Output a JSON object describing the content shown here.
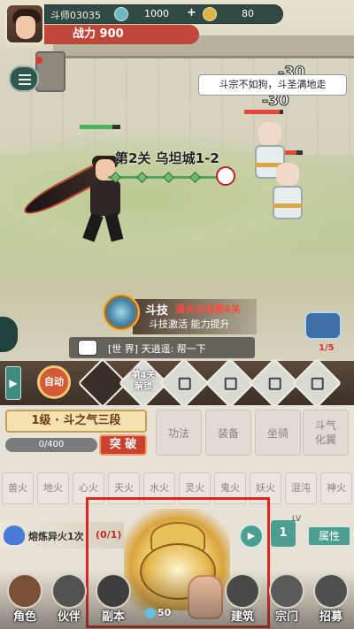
{
  "player": {
    "name": "斗师03035",
    "resource1": "1000",
    "plus": "+",
    "resource2": "80",
    "power": "战力 900"
  },
  "battle": {
    "stage_title": "第2关 乌坦城1-2",
    "damage": [
      "-30",
      "-30"
    ],
    "speech": "斗宗不如狗，斗圣满地走",
    "skill_name": "斗技",
    "skill_condition": "通关主线第4关",
    "skill_desc": "斗技激活 能力提升",
    "chest_count": "1/5"
  },
  "chat": {
    "text": "[世 界] 天逍遥: 帮一下"
  },
  "actions": {
    "expand": "▶",
    "auto": "自动",
    "slot_unlock": "第4关\n解锁"
  },
  "cultivation": {
    "level": "1级 · 斗之气三段",
    "xp": "0/400",
    "xp_progress": 0,
    "breakthrough": "突 破",
    "tabs": [
      "功法",
      "装备",
      "坐骑",
      "斗气\n化翼"
    ],
    "fires": [
      "兽火",
      "地火",
      "心火",
      "天火",
      "水火",
      "灵火",
      "鬼火",
      "妖火",
      "混沌",
      "神火"
    ],
    "refine": "熔炼异火1次",
    "refine_count": "(0/1)",
    "lv": "1",
    "lv_tag": "LV",
    "attr": "属性"
  },
  "bottom_nav": [
    "角色",
    "伙伴",
    "副本",
    "建筑",
    "宗门",
    "招募"
  ],
  "stones": "50"
}
